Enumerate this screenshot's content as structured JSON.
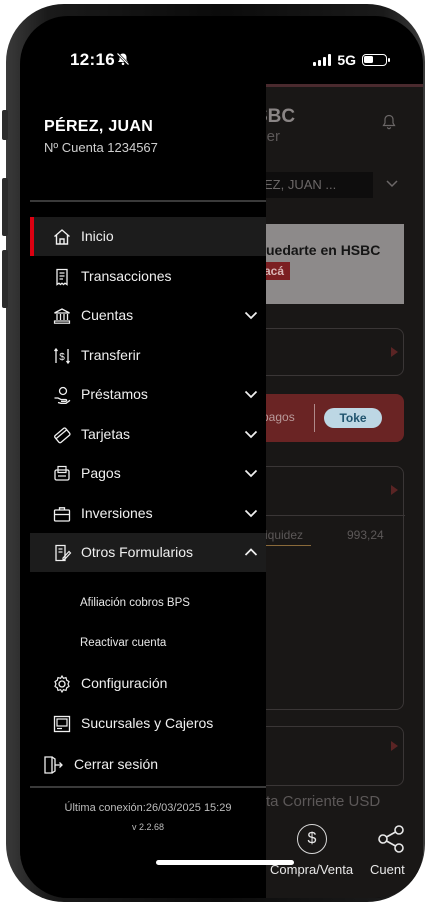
{
  "status_bar": {
    "time": "12:16",
    "network": "5G"
  },
  "background": {
    "brand": "SBC",
    "sub": "nier",
    "selector": "EZ, JUAN ...",
    "banner_text": "uedarte en HSBC",
    "banner_button": "acá",
    "pagos": "pagos",
    "toke": "Toke",
    "liquidez": "iquidez",
    "amount": "993,24",
    "account_label": "ta Corriente USD",
    "nav": [
      "Compra/Venta",
      "Cuent"
    ]
  },
  "user": {
    "name": "PÉREZ, JUAN",
    "account": "Nº Cuenta 1234567"
  },
  "menu": [
    {
      "label": "Inicio",
      "icon": "home-icon",
      "active": true
    },
    {
      "label": "Transacciones",
      "icon": "receipt-icon"
    },
    {
      "label": "Cuentas",
      "icon": "bank-icon",
      "chevron": "down"
    },
    {
      "label": "Transferir",
      "icon": "transfer-icon"
    },
    {
      "label": "Préstamos",
      "icon": "money-hand-icon",
      "chevron": "down"
    },
    {
      "label": "Tarjetas",
      "icon": "card-icon",
      "chevron": "down"
    },
    {
      "label": "Pagos",
      "icon": "payment-icon",
      "chevron": "down"
    },
    {
      "label": "Inversiones",
      "icon": "briefcase-icon",
      "chevron": "down"
    },
    {
      "label": "Otros Formularios",
      "icon": "form-icon",
      "chevron": "up",
      "expanded": true
    }
  ],
  "submenu": [
    "Afiliación cobros BPS",
    "Reactivar cuenta"
  ],
  "menu_bottom": [
    {
      "label": "Configuración",
      "icon": "gear-icon"
    },
    {
      "label": "Sucursales y Cajeros",
      "icon": "atm-icon"
    }
  ],
  "logout": "Cerrar sesión",
  "footer": {
    "last_connection": "Última conexión:26/03/2025 15:29",
    "version": "v 2.2.68"
  },
  "colors": {
    "accent": "#db0011",
    "drawer_bg": "#000000",
    "highlight_bg": "#1c1c1c"
  }
}
